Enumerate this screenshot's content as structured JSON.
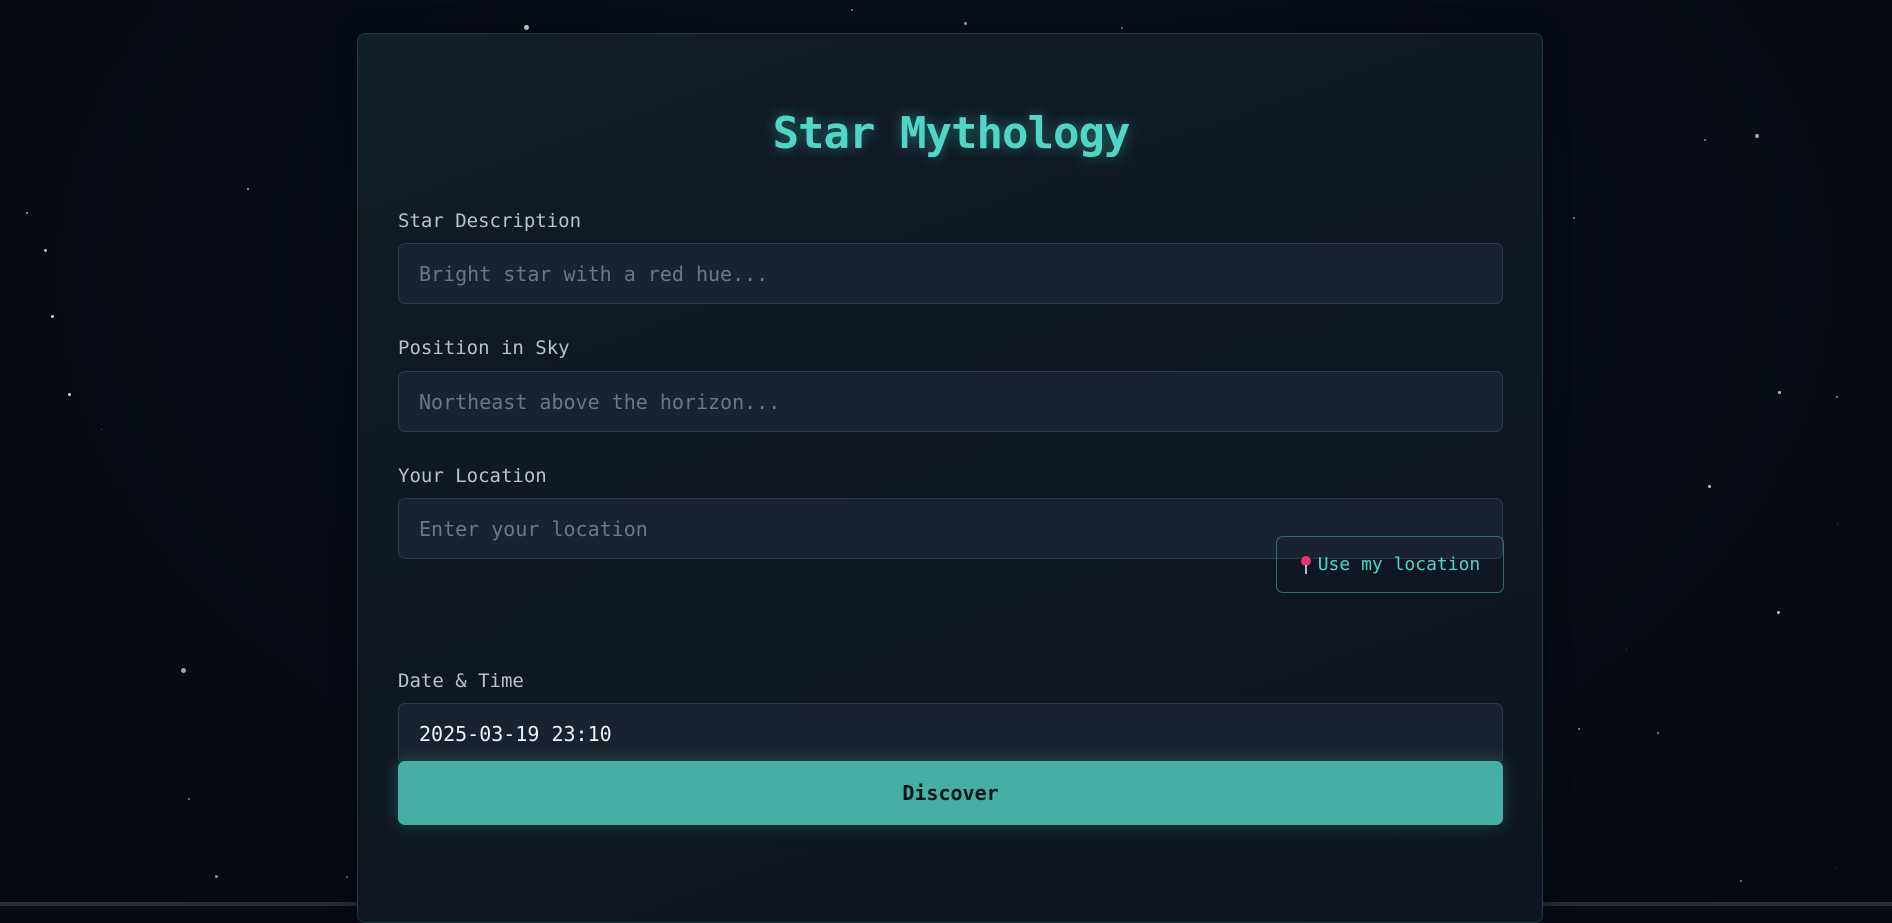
{
  "app": {
    "title": "Star Mythology"
  },
  "form": {
    "star_description": {
      "label": "Star Description",
      "placeholder": "Bright star with a red hue...",
      "value": ""
    },
    "position": {
      "label": "Position in Sky",
      "placeholder": "Northeast above the horizon...",
      "value": ""
    },
    "location": {
      "label": "Your Location",
      "placeholder": "Enter your location",
      "value": "",
      "use_location_label": "Use my location",
      "use_location_icon": "pushpin-icon"
    },
    "datetime": {
      "label": "Date & Time",
      "value": "2025-03-19 23:10"
    },
    "submit_label": "Discover"
  },
  "colors": {
    "accent": "#4fd6c6",
    "button": "#45aea7",
    "background": "#060b14",
    "card": "#0f1a24",
    "input": "#19222f",
    "pin": "#e8336f"
  }
}
